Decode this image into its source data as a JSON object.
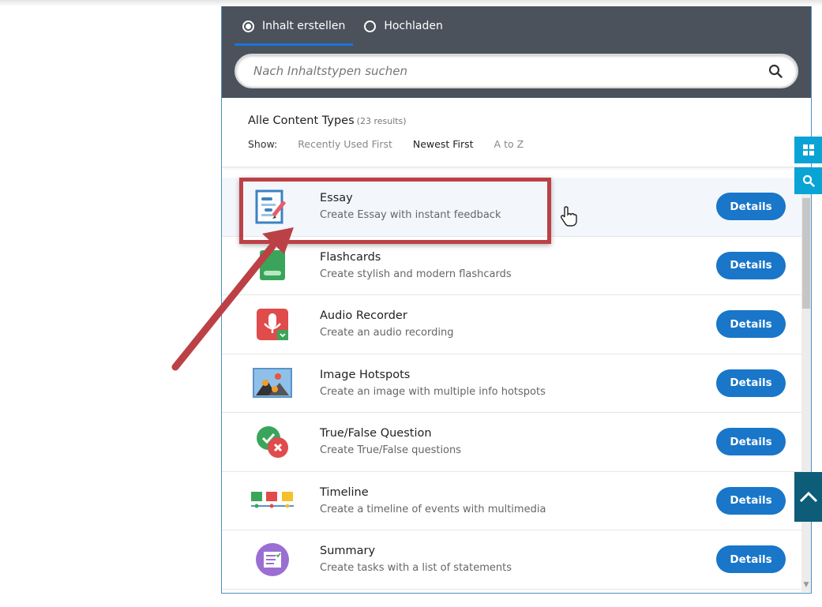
{
  "tabs": [
    {
      "label": "Inhalt erstellen",
      "selected": true
    },
    {
      "label": "Hochladen",
      "selected": false
    }
  ],
  "search": {
    "placeholder": "Nach Inhaltstypen suchen",
    "icon": "search-icon"
  },
  "header": {
    "title": "Alle Content Types",
    "count": "(23 results)",
    "show_label": "Show:",
    "sort_options": [
      {
        "label": "Recently Used First",
        "selected": false
      },
      {
        "label": "Newest First",
        "selected": true
      },
      {
        "label": "A to Z",
        "selected": false
      }
    ]
  },
  "items": [
    {
      "name": "Essay",
      "desc": "Create Essay with instant feedback",
      "button": "Details",
      "icon": "essay-icon"
    },
    {
      "name": "Flashcards",
      "desc": "Create stylish and modern flashcards",
      "button": "Details",
      "icon": "flashcards-icon"
    },
    {
      "name": "Audio Recorder",
      "desc": "Create an audio recording",
      "button": "Details",
      "icon": "audio-recorder-icon"
    },
    {
      "name": "Image Hotspots",
      "desc": "Create an image with multiple info hotspots",
      "button": "Details",
      "icon": "image-hotspots-icon"
    },
    {
      "name": "True/False Question",
      "desc": "Create True/False questions",
      "button": "Details",
      "icon": "true-false-icon"
    },
    {
      "name": "Timeline",
      "desc": "Create a timeline of events with multimedia",
      "button": "Details",
      "icon": "timeline-icon"
    },
    {
      "name": "Summary",
      "desc": "Create tasks with a list of statements",
      "button": "Details",
      "icon": "summary-icon"
    }
  ],
  "colors": {
    "tabbar": "#4b525b",
    "button": "#1976c8",
    "annotation": "#bc4146",
    "side_button": "#0aa3d6",
    "back_to_top": "#0d5d78"
  }
}
